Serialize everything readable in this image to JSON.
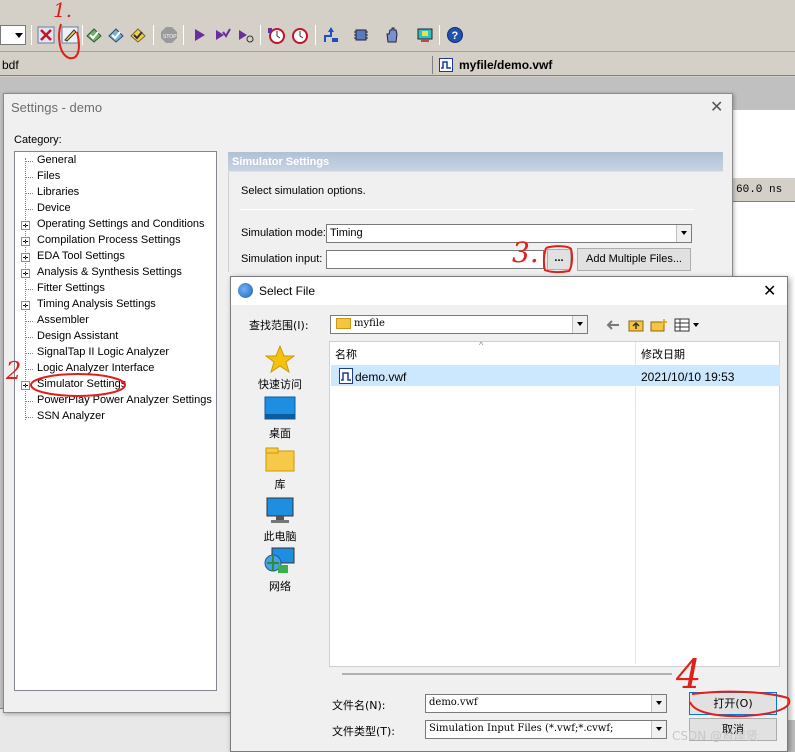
{
  "toolbar": {
    "icons": [
      "stop-x-icon",
      "pencil-settings-icon",
      "check-icon",
      "check-multi-icon",
      "check-open-icon",
      "stop-sign-icon",
      "play-icon",
      "run-check-icon",
      "step-icon",
      "timer-icon",
      "timer-stop-icon",
      "compile-icon",
      "chip-icon",
      "hand-icon",
      "programmer-icon",
      "help-icon"
    ]
  },
  "tabs": {
    "left_fragment": "bdf",
    "active_file": "myfile/demo.vwf"
  },
  "waveform": {
    "time_value": "60.0 ns"
  },
  "settings": {
    "title": "Settings - demo",
    "category_label": "Category:",
    "tree": [
      {
        "label": "General",
        "expandable": false
      },
      {
        "label": "Files",
        "expandable": false
      },
      {
        "label": "Libraries",
        "expandable": false
      },
      {
        "label": "Device",
        "expandable": false
      },
      {
        "label": "Operating Settings and Conditions",
        "expandable": true
      },
      {
        "label": "Compilation Process Settings",
        "expandable": true
      },
      {
        "label": "EDA Tool Settings",
        "expandable": true
      },
      {
        "label": "Analysis & Synthesis Settings",
        "expandable": true
      },
      {
        "label": "Fitter Settings",
        "expandable": false
      },
      {
        "label": "Timing Analysis Settings",
        "expandable": true
      },
      {
        "label": "Assembler",
        "expandable": false
      },
      {
        "label": "Design Assistant",
        "expandable": false
      },
      {
        "label": "SignalTap II Logic Analyzer",
        "expandable": false
      },
      {
        "label": "Logic Analyzer Interface",
        "expandable": false
      },
      {
        "label": "Simulator Settings",
        "expandable": true
      },
      {
        "label": "PowerPlay Power Analyzer Settings",
        "expandable": false
      },
      {
        "label": "SSN Analyzer",
        "expandable": false
      }
    ],
    "panel": {
      "header": "Simulator Settings",
      "description": "Select simulation options.",
      "mode_label": "Simulation mode:",
      "mode_value": "Timing",
      "input_label": "Simulation input:",
      "input_value": "",
      "browse_label": "...",
      "add_multiple_label": "Add Multiple Files..."
    }
  },
  "select_file": {
    "title": "Select File",
    "look_in_label": "查找范围(I):",
    "look_in_value": "myfile",
    "places": [
      "快速访问",
      "桌面",
      "库",
      "此电脑",
      "网络"
    ],
    "columns": {
      "name": "名称",
      "date": "修改日期"
    },
    "files": [
      {
        "name": "demo.vwf",
        "date": "2021/10/10 19:53"
      }
    ],
    "filename_label": "文件名(N):",
    "filename_value": "demo.vwf",
    "filetype_label": "文件类型(T):",
    "filetype_value": "Simulation Input Files (*.vwf;*.cvwf;",
    "open_label": "打开(O)",
    "cancel_label": "取消"
  },
  "annotations": [
    "1.",
    "2",
    "3.",
    "4"
  ],
  "watermark": "CSDN @肖岸贤",
  "colors": {
    "annotation_red": "#e0201b",
    "selection_blue": "#cce8ff",
    "panel_header": "#b0c0d4"
  }
}
